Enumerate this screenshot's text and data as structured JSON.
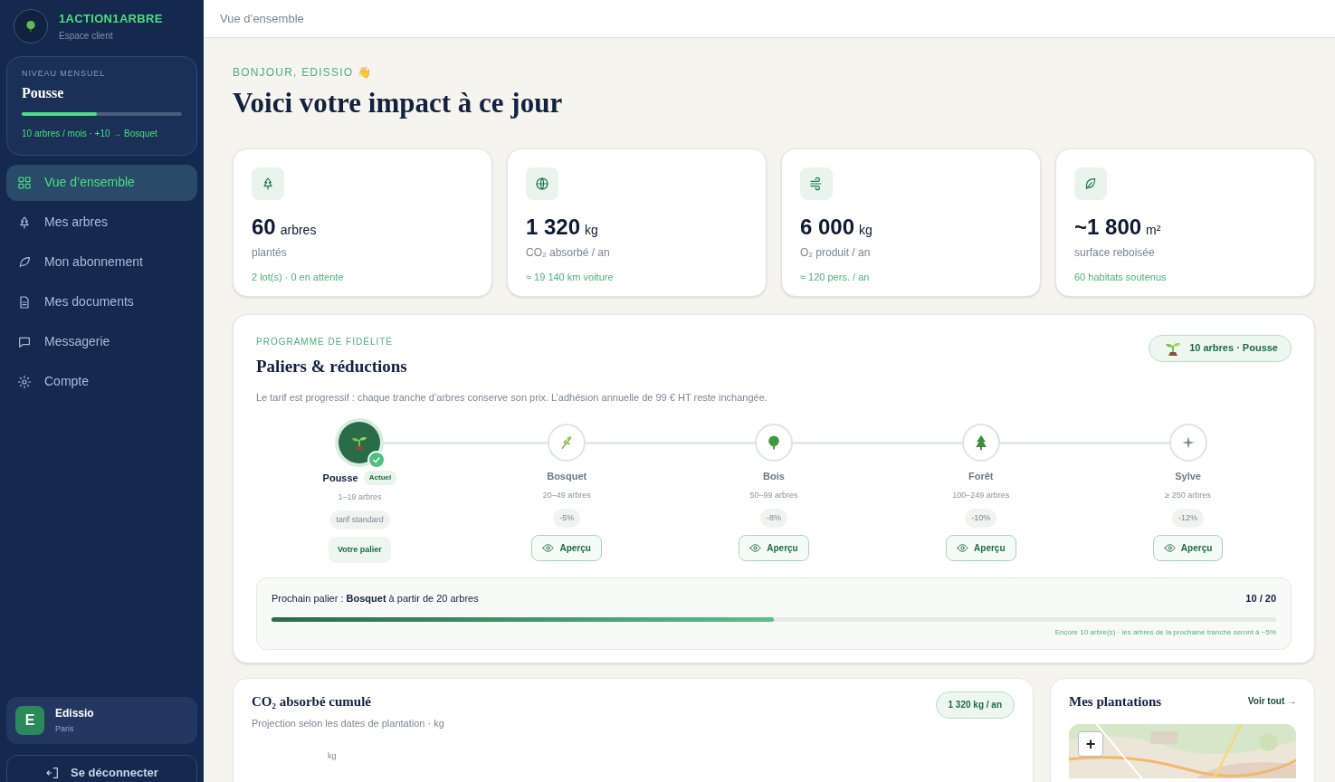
{
  "brand": {
    "name": "1ACTION1ARBRE",
    "subtitle": "Espace client"
  },
  "level_card": {
    "label": "NIVEAU MENSUEL",
    "name": "Pousse",
    "level": 0.47,
    "note": "10 arbres / mois · +10 → Bosquet"
  },
  "nav": [
    {
      "label": "Vue d’ensemble",
      "selected": true
    },
    {
      "label": "Mes arbres",
      "selected": false
    },
    {
      "label": "Mon abonnement",
      "selected": false
    },
    {
      "label": "Mes documents",
      "selected": false
    },
    {
      "label": "Messagerie",
      "selected": false
    },
    {
      "label": "Compte",
      "selected": false
    }
  ],
  "user": {
    "initial": "E",
    "name": "Edissio",
    "city": "Paris"
  },
  "logout": "Se déconnecter",
  "breadcrumb": "Vue d’ensemble",
  "greeting": "BONJOUR, EDISSIO 👋",
  "title": "Voici votre impact à ce jour",
  "stats": [
    {
      "value": "60",
      "unit": "arbres",
      "label": "plantés",
      "note": "2 lot(s) · 0 en attente"
    },
    {
      "value": "1 320",
      "unit": "kg",
      "label": "CO₂ absorbé / an",
      "note": "≈ 19 140 km voiture"
    },
    {
      "value": "6 000",
      "unit": "kg",
      "label": "O₂ produit / an",
      "note": "≈ 120 pers. / an"
    },
    {
      "value": "~1 800",
      "unit": "m²",
      "label": "surface reboisée",
      "note": "60 habitats soutenus"
    }
  ],
  "loyalty": {
    "eyebrow": "PROGRAMME DE FIDÉLITÉ",
    "title": "Paliers & réductions",
    "badge": "10 arbres · Pousse",
    "description": "Le tarif est progressif : chaque tranche d’arbres conserve son prix. L’adhésion annuelle de 99 € HT reste inchangée.",
    "tiers": [
      {
        "name": "Pousse",
        "tag": "Actuel",
        "range": "1–19 arbres",
        "discount": "tarif standard",
        "button": "Votre palier",
        "selected": true
      },
      {
        "name": "Bosquet",
        "range": "20–49 arbres",
        "discount": "-5%",
        "button": "Aperçu",
        "selected": false
      },
      {
        "name": "Bois",
        "range": "50–99 arbres",
        "discount": "-8%",
        "button": "Aperçu",
        "selected": false
      },
      {
        "name": "Forêt",
        "range": "100–249 arbres",
        "discount": "-10%",
        "button": "Aperçu",
        "selected": false
      },
      {
        "name": "Sylve",
        "range": "≥ 250 arbres",
        "discount": "-12%",
        "button": "Aperçu",
        "selected": false
      }
    ],
    "next": {
      "text": "Prochain palier : **Bosquet** à partir de 20 arbres",
      "count": "10 / 20",
      "level": 0.5,
      "note": "Encore 10 arbre(s) · les arbres de la prochaine tranche seront à −5%"
    }
  },
  "co2_card": {
    "title": "CO₂ absorbé cumulé",
    "badge": "1 320 kg / an",
    "subtitle": "Projection selon les dates de plantation · kg",
    "axis_label": "kg"
  },
  "plantations": {
    "title": "Mes plantations",
    "link": "Voir tout →",
    "zoom_button": "+"
  }
}
